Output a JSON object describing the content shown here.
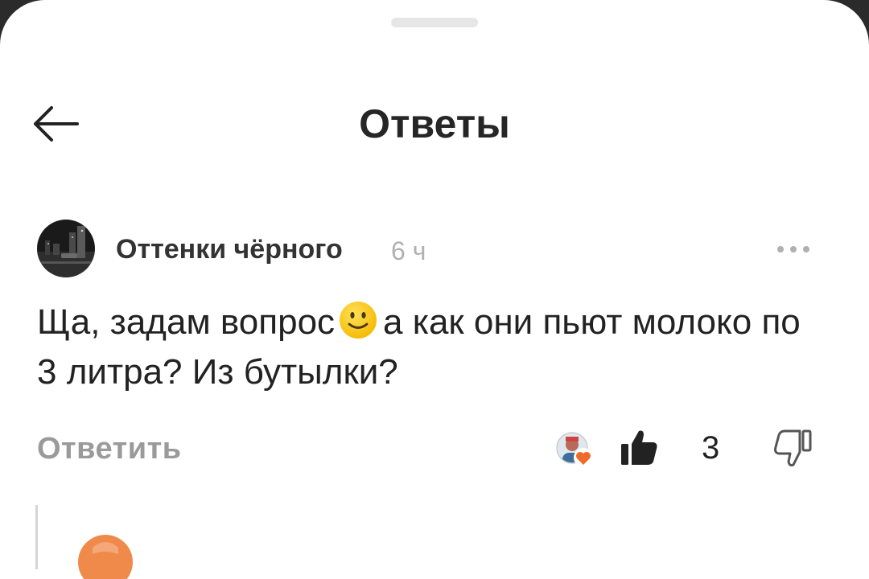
{
  "header": {
    "title": "Ответы",
    "back_icon": "arrow-left-icon"
  },
  "comment": {
    "author": "Оттенки чёрного",
    "time": "6 ч",
    "text_part1": "Ща, задам вопрос",
    "emoji": "slightly-smiling-face-icon",
    "text_part2": "а как они пьют молоко по 3 литра? Из бутылки?",
    "more_icon": "more-horizontal-icon"
  },
  "actions": {
    "reply_label": "Ответить",
    "like_count": "3",
    "like_icon": "thumbs-up-icon",
    "dislike_icon": "thumbs-down-icon",
    "reactors_icon": "reactors-avatar-heart-icon"
  },
  "colors": {
    "accent": "#f06a2a",
    "text_primary": "#222222",
    "text_muted": "#9a9a9a"
  }
}
